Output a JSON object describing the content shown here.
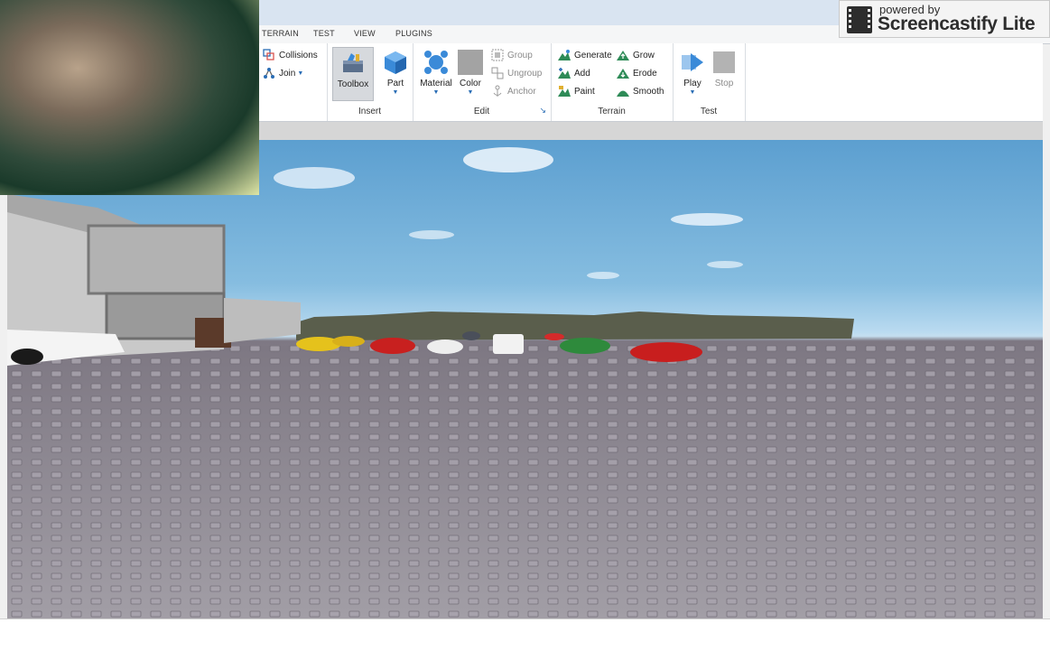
{
  "ribbon": {
    "tabs": [
      {
        "label": "TERRAIN"
      },
      {
        "label": "TEST"
      },
      {
        "label": "VIEW"
      },
      {
        "label": "PLUGINS"
      }
    ],
    "tools": {
      "collisions": "Collisions",
      "join": "Join"
    },
    "insert": {
      "label": "Insert",
      "toolbox": "Toolbox",
      "part": "Part"
    },
    "edit": {
      "label": "Edit",
      "material": "Material",
      "color": "Color",
      "group": "Group",
      "ungroup": "Ungroup",
      "anchor": "Anchor"
    },
    "terrain": {
      "label": "Terrain",
      "generate": "Generate",
      "add": "Add",
      "paint": "Paint",
      "grow": "Grow",
      "erode": "Erode",
      "smooth": "Smooth"
    },
    "test": {
      "label": "Test",
      "play": "Play",
      "stop": "Stop"
    }
  },
  "overlay": {
    "powered_by": "powered by",
    "brand": "Screencastify Lite"
  },
  "colors": {
    "accent_blue": "#2a6db5",
    "terrain_green": "#2e8b57",
    "sky": "#86bde0",
    "baseplate": "#8f8a94"
  }
}
